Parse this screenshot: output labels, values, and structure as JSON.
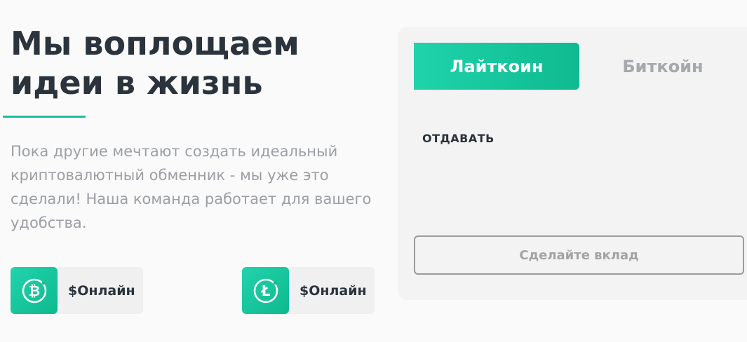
{
  "hero": {
    "title": "Мы воплощаем идеи в жизнь",
    "description": "Пока другие мечтают создать идеальный криптовалютный обменник - мы уже это сделали! Наша команда работает для вашего удобства."
  },
  "status_cards": [
    {
      "icon": "bitcoin-icon",
      "label": "$Онлайн"
    },
    {
      "icon": "litecoin-icon",
      "label": "$Онлайн"
    }
  ],
  "exchange": {
    "tabs": [
      {
        "label": "Лайткоин",
        "active": true
      },
      {
        "label": "Биткойн",
        "active": false
      }
    ],
    "give_label": "ОТДАВАТЬ",
    "deposit_button": "Сделайте вклад"
  },
  "colors": {
    "accent": "#1dbf9a",
    "text_dark": "#2b333d",
    "text_muted": "#9b9fa4"
  }
}
